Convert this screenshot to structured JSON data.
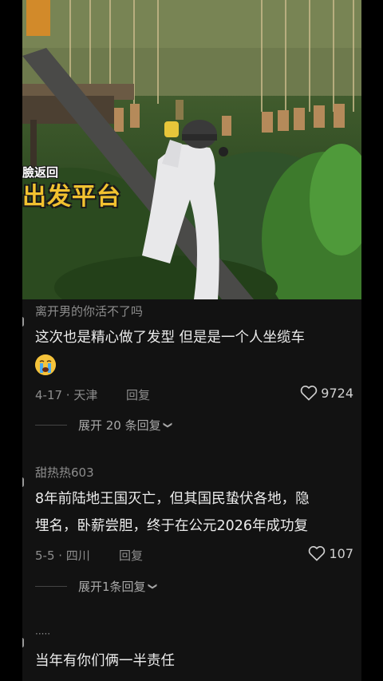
{
  "video": {
    "caption_top": "臉返回",
    "caption_main": "出发平台"
  },
  "comments": [
    {
      "username": "离开男的你活不了吗",
      "text_lines": [
        "这次也是精心做了发型 但是是一个人坐缆车"
      ],
      "emoji": "crying-face",
      "date_location": "4-17 · 天津",
      "reply_label": "回复",
      "likes": "9724",
      "expand_label": "展开 20 条回复"
    },
    {
      "username": "甜热热603",
      "text_lines": [
        "8年前陆地王国灭亡，但其国民蛰伏各地，隐",
        "埋名，卧薪尝胆，终于在公元2026年成功复"
      ],
      "date_location": "5-5 · 四川",
      "reply_label": "回复",
      "likes": "107",
      "expand_label": "展开1条回复"
    },
    {
      "username": "·····",
      "text_lines": [
        "当年有你们俩一半责任"
      ]
    }
  ],
  "colors": {
    "background": "#121212",
    "text_primary": "#ececec",
    "text_secondary": "#8d8d8d",
    "caption_yellow": "#f2c230"
  },
  "icons": {
    "like": "heart-outline-icon",
    "expand": "chevron-down-icon"
  }
}
